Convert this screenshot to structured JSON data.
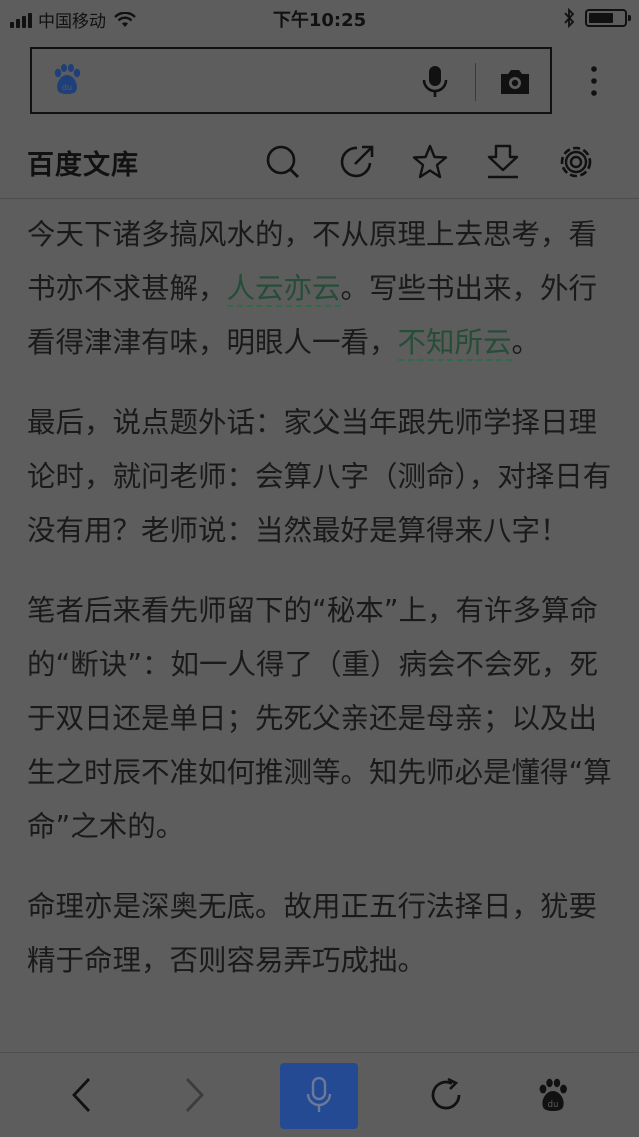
{
  "status_bar": {
    "carrier": "中国移动",
    "time": "下午10:25",
    "battery_level": 0.7
  },
  "search": {
    "placeholder": ""
  },
  "header": {
    "site_title": "百度文库"
  },
  "article": {
    "p1": {
      "before_link1": "今天下诸多搞风水的，不从原理上去思考，看书亦不求甚解，",
      "link1": "人云亦云",
      "between": "。写些书出来，外行看得津津有味，明眼人一看，",
      "link2": "不知所云",
      "after": "。"
    },
    "p2": "最后，说点题外话：家父当年跟先师学择日理论时，就问老师：会算八字（测命），对择日有没有用？老师说：当然最好是算得来八字！",
    "p3": "笔者后来看先师留下的“秘本”上，有许多算命的“断诀”：如一人得了（重）病会不会死，死于双日还是单日；先死父亲还是母亲；以及出生之时辰不准如何推测等。知先师必是懂得“算命”之术的。",
    "p4": "命理亦是深奥无底。故用正五行法择日，犹要精于命理，否则容易弄巧成拙。"
  },
  "colors": {
    "background": "#5d5d5d",
    "voice_button": "#234a93",
    "link": "#264d38"
  },
  "icons": {
    "search_box_logo": "baidu-paw-icon",
    "voice": "microphone-icon",
    "camera": "camera-icon",
    "more": "more-vertical-icon",
    "header": [
      "search-icon",
      "share-icon",
      "star-icon",
      "download-icon",
      "settings-icon"
    ],
    "bottom": [
      "back-icon",
      "forward-icon",
      "microphone-icon",
      "refresh-icon",
      "baidu-paw-icon"
    ]
  }
}
